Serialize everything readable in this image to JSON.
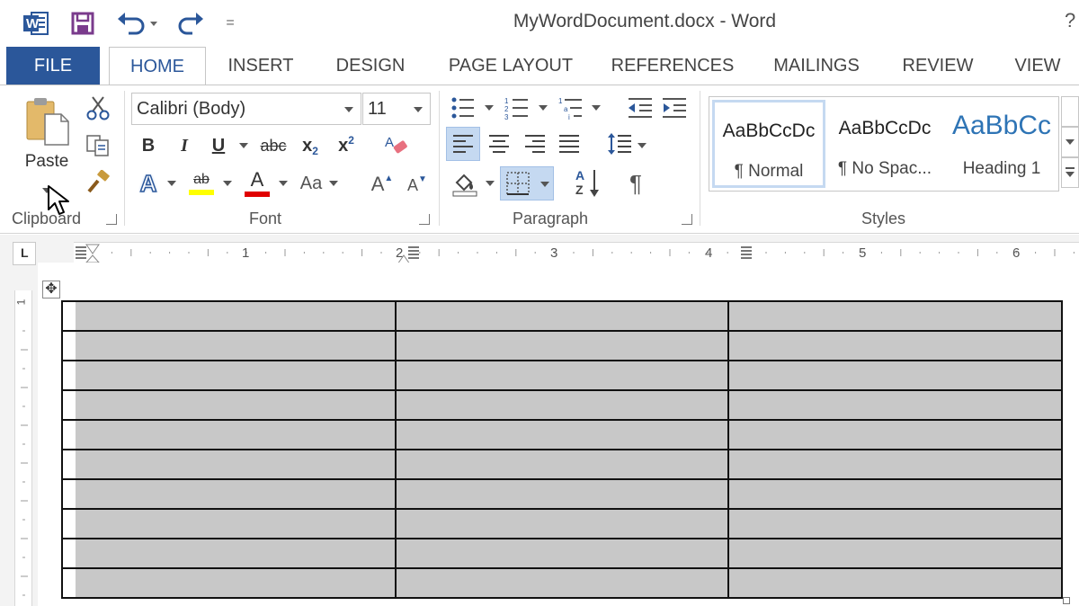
{
  "window": {
    "title": "MyWordDocument.docx - Word",
    "help_glyph": "?"
  },
  "quick_access": {
    "app_icon_letter": "W",
    "customize_glyph": "="
  },
  "tabs": {
    "file": "FILE",
    "items": [
      {
        "id": "home",
        "label": "HOME",
        "active": true
      },
      {
        "id": "insert",
        "label": "INSERT"
      },
      {
        "id": "design",
        "label": "DESIGN"
      },
      {
        "id": "page_layout",
        "label": "PAGE LAYOUT"
      },
      {
        "id": "references",
        "label": "REFERENCES"
      },
      {
        "id": "mailings",
        "label": "MAILINGS"
      },
      {
        "id": "review",
        "label": "REVIEW"
      },
      {
        "id": "view",
        "label": "VIEW"
      }
    ]
  },
  "ribbon": {
    "clipboard": {
      "label": "Clipboard",
      "paste": "Paste"
    },
    "font": {
      "label": "Font",
      "font_name": "Calibri (Body)",
      "font_size": "11",
      "bold": "B",
      "italic": "I",
      "underline": "U",
      "strike": "abc",
      "subscript": "x",
      "subscript_mark": "2",
      "superscript": "x",
      "superscript_mark": "2",
      "text_effects": "A",
      "highlight": "ab",
      "font_color": "A",
      "change_case": "Aa",
      "grow": "A",
      "shrink": "A"
    },
    "paragraph": {
      "label": "Paragraph",
      "pilcrow": "¶",
      "sort_a": "A",
      "sort_z": "Z"
    },
    "styles": {
      "label": "Styles",
      "items": [
        {
          "sample": "AaBbCcDc",
          "name": "¶ Normal",
          "active": true
        },
        {
          "sample": "AaBbCcDc",
          "name": "¶ No Spac..."
        },
        {
          "sample": "AaBbCc",
          "name": "Heading 1",
          "heading": true
        }
      ]
    }
  },
  "ruler": {
    "tab_glyph": "L",
    "numbers": [
      "1",
      "2",
      "3",
      "4",
      "5",
      "6"
    ],
    "v_numbers": [
      "1"
    ]
  },
  "document": {
    "move_handle_glyph": "✥",
    "table": {
      "rows": 10,
      "cols": 3
    }
  },
  "colors": {
    "file_tab": "#2b579a",
    "accent_blue": "#2b579a",
    "cell_shading": "#c8c8c8",
    "font_color_bar": "#e00000",
    "highlight_bar": "#ffff00",
    "heading_blue": "#2e74b5"
  },
  "icons": [
    "word-app-icon",
    "save-icon",
    "undo-icon",
    "redo-icon",
    "cut-icon",
    "copy-icon",
    "format-painter-icon",
    "bullets-icon",
    "numbering-icon",
    "multilevel-list-icon",
    "decrease-indent-icon",
    "increase-indent-icon",
    "align-left-icon",
    "center-icon",
    "align-right-icon",
    "justify-icon",
    "line-spacing-icon",
    "shading-icon",
    "borders-icon",
    "sort-icon",
    "show-hide-icon",
    "mouse-pointer-icon"
  ]
}
